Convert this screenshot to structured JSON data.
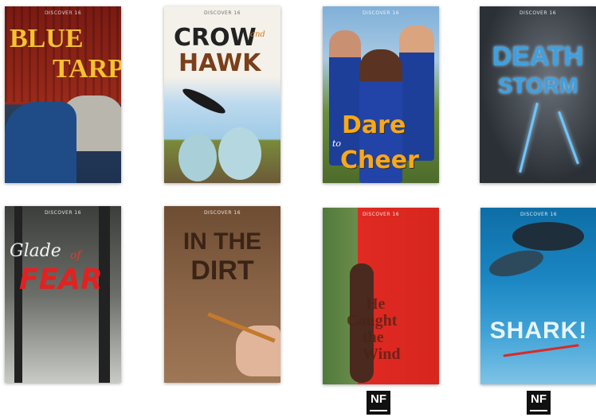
{
  "series_label": "DISCOVER 16",
  "books": [
    {
      "title_lines": [
        "BLUE",
        "TARP"
      ]
    },
    {
      "title_lines": [
        "CROW",
        "and",
        "HAWK"
      ]
    },
    {
      "title_lines": [
        "Dare",
        "to",
        "Cheer"
      ]
    },
    {
      "title_lines": [
        "DEATH",
        "STORM"
      ]
    },
    {
      "title_lines": [
        "Glade",
        "of",
        "FEAR"
      ]
    },
    {
      "title_lines": [
        "IN THE",
        "DIRT"
      ]
    },
    {
      "title_lines": [
        "He",
        "Caught",
        "the",
        "Wind"
      ]
    },
    {
      "title_lines": [
        "SHARK!"
      ]
    }
  ],
  "badges": [
    "NF",
    "NF"
  ]
}
